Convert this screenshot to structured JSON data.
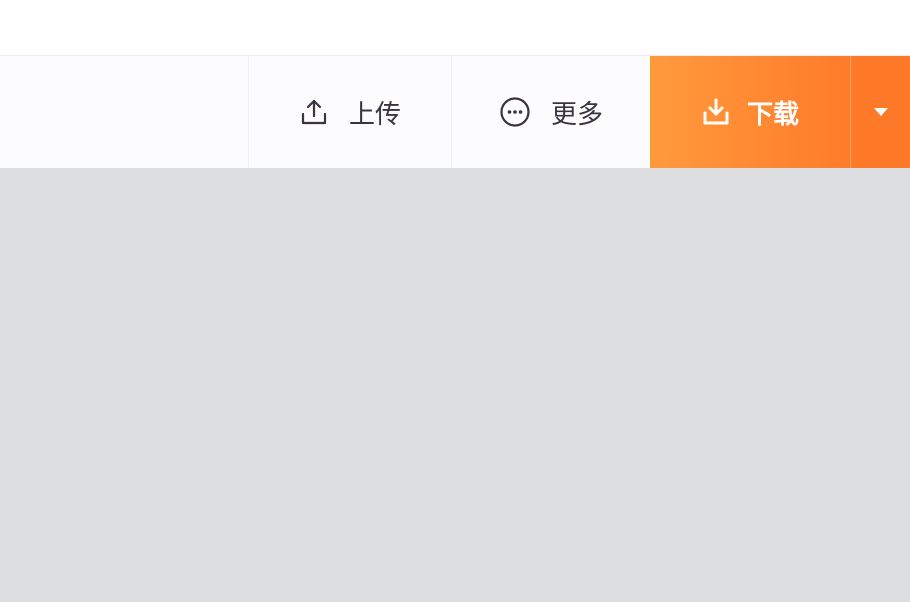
{
  "toolbar": {
    "upload": {
      "label": "上传",
      "icon": "upload-icon"
    },
    "more": {
      "label": "更多",
      "icon": "more-circle-icon"
    },
    "download": {
      "label": "下载",
      "icon": "download-icon",
      "color": "#ff7b2a"
    },
    "dropdown": {
      "icon": "caret-down-icon"
    }
  }
}
